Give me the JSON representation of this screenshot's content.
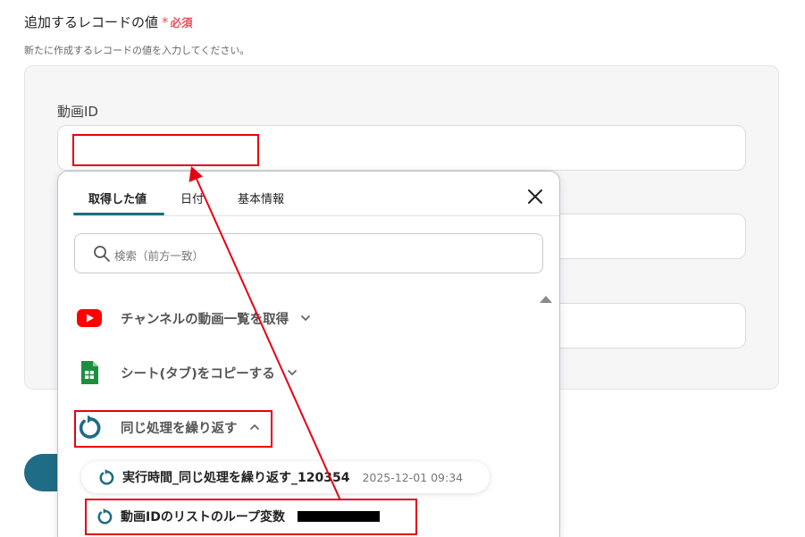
{
  "section": {
    "title": "追加するレコードの値",
    "required_mark": "*",
    "required_text": "必須",
    "description": "新たに作成するレコードの値を入力してください。"
  },
  "fields": [
    {
      "label": "動画ID",
      "value": ""
    }
  ],
  "popup": {
    "tabs": [
      {
        "label": "取得した値",
        "active": true
      },
      {
        "label": "日付",
        "active": false
      },
      {
        "label": "基本情報",
        "active": false
      }
    ],
    "search": {
      "placeholder": "検索（前方一致）"
    },
    "groups": [
      {
        "label": "チャンネルの動画一覧を取得",
        "icon": "youtube-icon",
        "expanded": false
      },
      {
        "label": "シート(タブ)をコピーする",
        "icon": "google-sheets-icon",
        "expanded": false
      },
      {
        "label": "同じ処理を繰り返す",
        "icon": "loop-icon",
        "expanded": true
      }
    ],
    "sub_items": [
      {
        "label": "実行時間_同じ処理を繰り返す_120354",
        "timestamp": "2025-12-01 09:34"
      },
      {
        "label": "動画IDのリストのループ変数",
        "value_redacted": true
      }
    ]
  },
  "colors": {
    "accent": "#1f6c86",
    "required": "#e8505b",
    "annotation": "#e60012",
    "youtube": "#ff0000",
    "sheets": "#1e8e3e"
  }
}
